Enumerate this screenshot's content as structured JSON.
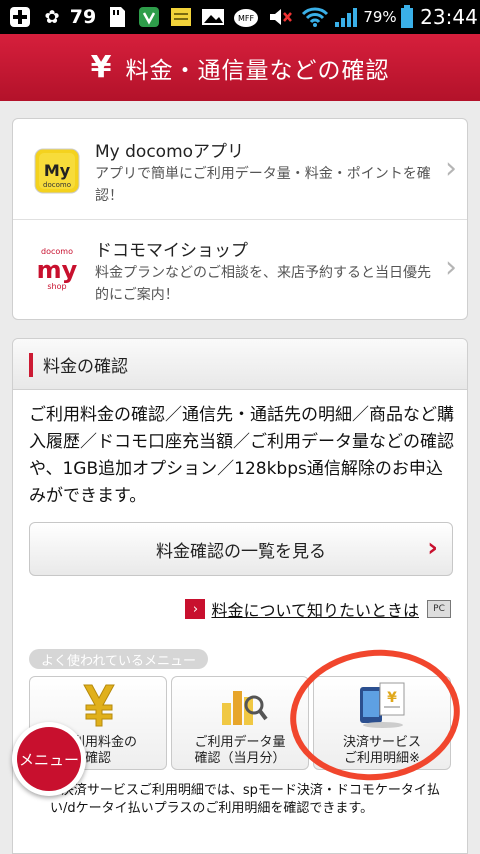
{
  "status_bar": {
    "notification_count": "79",
    "battery_percent": "79%",
    "time": "23:44"
  },
  "header": {
    "icon": "yen-icon",
    "title": "料金・通信量などの確認"
  },
  "apps": [
    {
      "icon_text_top": "My",
      "icon_text_bottom": "docomo",
      "title": "My docomoアプリ",
      "description": "アプリで簡単にご利用データ量・料金・ポイントを確認！"
    },
    {
      "icon_text_top": "docomo",
      "icon_text_mid": "my",
      "icon_text_bottom": "shop",
      "title": "ドコモマイショップ",
      "description": "料金プランなどのご相談を、来店予約すると当日優先的にご案内！"
    }
  ],
  "fee_section": {
    "title": "料金の確認",
    "description": "ご利用料金の確認／通信先・通話先の明細／商品など購入履歴／ドコモ口座充当額／ご利用データ量などの確認や、1GB追加オプション／128kbps通信解除のお申込みができます。",
    "main_button": "料金確認の一覧を見る",
    "link": "料金について知りたいときは",
    "pc_badge": "PC",
    "menu_label": "よく使われているメニュー",
    "tiles": [
      {
        "line1": "ご利用料金の",
        "line2": "確認"
      },
      {
        "line1": "ご利用データ量",
        "line2": "確認（当月分）"
      },
      {
        "line1": "決済サービス",
        "line2": "ご利用明細※"
      }
    ],
    "note": "※決済サービスご利用明細では、spモード決済・ドコモケータイ払い/dケータイ払いプラスのご利用明細を確認できます。"
  },
  "menu_button": "メニュー",
  "colors": {
    "brand_red": "#c8102e",
    "annotation_circle": "#f1462d"
  }
}
